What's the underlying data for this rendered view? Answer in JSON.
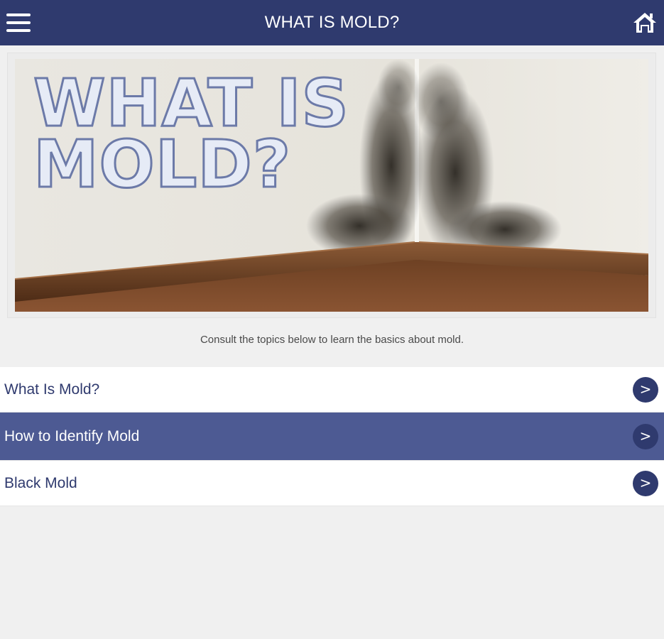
{
  "header": {
    "title": "WHAT IS MOLD?",
    "menu_icon": "hamburger-menu-icon",
    "home_icon": "home-icon"
  },
  "hero": {
    "overlay_line1": "WHAT IS",
    "overlay_line2": "MOLD?"
  },
  "intro_text": "Consult the topics below to learn the basics about mold.",
  "topics": [
    {
      "label": "What Is Mold?",
      "chevron": ">",
      "active": false
    },
    {
      "label": "How to Identify Mold",
      "chevron": ">",
      "active": true
    },
    {
      "label": "Black Mold",
      "chevron": ">",
      "active": false
    }
  ],
  "colors": {
    "header_bg": "#2f3a6e",
    "active_row_bg": "#4d5a93",
    "page_bg": "#f0f0f0",
    "chevron_bg": "#2f3a6e"
  }
}
